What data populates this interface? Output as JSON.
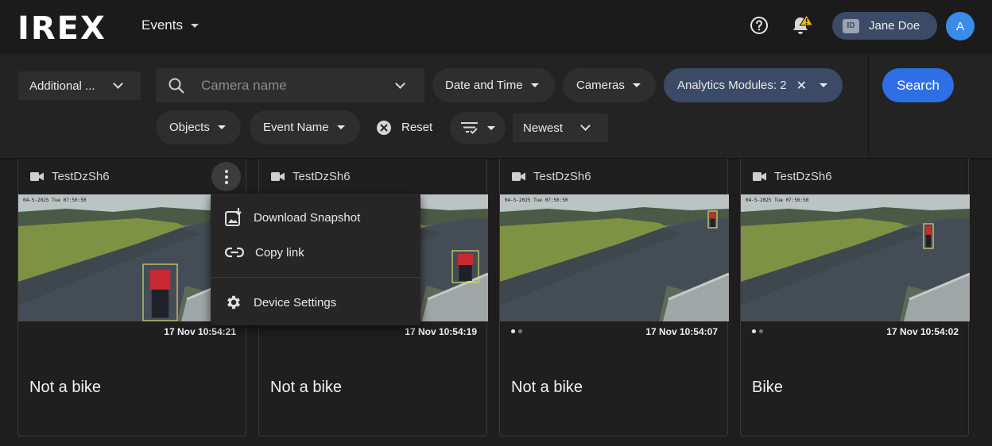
{
  "header": {
    "logo": "IREX",
    "nav_label": "Events",
    "user_name": "Jane Doe",
    "id_badge": "ID",
    "avatar_initial": "A"
  },
  "filters": {
    "additional_label": "Additional ...",
    "camera_placeholder": "Camera name",
    "date_time_label": "Date and Time",
    "cameras_label": "Cameras",
    "analytics_label": "Analytics Modules: 2",
    "search_label": "Search",
    "objects_label": "Objects",
    "event_name_label": "Event Name",
    "reset_label": "Reset",
    "sort_label": "Newest"
  },
  "cards": [
    {
      "camera": "TestDzSh6",
      "timestamp": "17 Nov 10:54:21",
      "title": "Not a bike"
    },
    {
      "camera": "TestDzSh6",
      "timestamp": "17 Nov 10:54:19",
      "title": "Not a bike"
    },
    {
      "camera": "TestDzSh6",
      "timestamp": "17 Nov 10:54:07",
      "title": "Not a bike"
    },
    {
      "camera": "TestDzSh6",
      "timestamp": "17 Nov 10:54:02",
      "title": "Bike"
    }
  ],
  "menu": {
    "download_snapshot": "Download Snapshot",
    "copy_link": "Copy link",
    "device_settings": "Device Settings"
  },
  "colors": {
    "accent": "#2f6fe6",
    "selected_pill": "#3b4a66",
    "warning": "#f5b800",
    "bbox": "#d9d86a"
  },
  "icons": [
    "help-icon",
    "bell-icon",
    "warning-icon",
    "search-icon",
    "camera-icon",
    "kebab-icon",
    "download-snapshot-icon",
    "link-icon",
    "gear-icon",
    "close-circle-icon",
    "filter-sort-icon"
  ]
}
